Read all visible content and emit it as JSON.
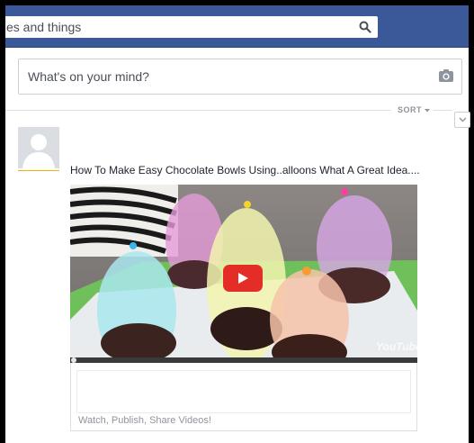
{
  "header": {
    "search_value": "es and things",
    "icons": {
      "search": "search-icon"
    }
  },
  "composer": {
    "prompt": "What's on your mind?",
    "icons": {
      "camera": "camera-icon"
    }
  },
  "feed": {
    "sort_label": "SORT",
    "icons": {
      "sort_arrow": "caret-down-icon",
      "options": "chevron-down-icon"
    }
  },
  "post": {
    "icons": {
      "avatar": "default-avatar-icon"
    },
    "title": "How To Make Easy Chocolate Bowls Using..alloons What A Great Idea....",
    "video": {
      "icons": {
        "play": "play-icon"
      },
      "watermark": "YouTube"
    },
    "link_caption": "Watch, Publish, Share Videos!"
  },
  "colors": {
    "topbar": "#3b5998",
    "play_button": "#e52d27",
    "text_primary": "#1d2129",
    "text_muted": "#90949c"
  }
}
